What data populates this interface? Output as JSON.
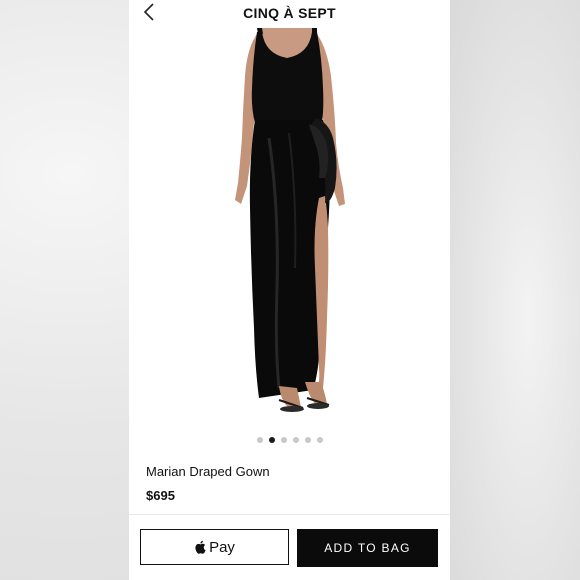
{
  "header": {
    "brand": "CINQ À SEPT",
    "back_icon": "chevron-left-icon"
  },
  "gallery": {
    "image_subject": "black-draped-gown-photo",
    "dot_count": 6,
    "active_index": 1
  },
  "product": {
    "name": "Marian Draped Gown",
    "price": "$695"
  },
  "actions": {
    "apple_pay_label": "Pay",
    "apple_pay_icon": "apple-icon",
    "add_to_bag_label": "ADD TO BAG"
  },
  "colors": {
    "accent": "#0b0b0b",
    "background": "#ffffff",
    "dot_inactive": "#c8c8c8"
  }
}
